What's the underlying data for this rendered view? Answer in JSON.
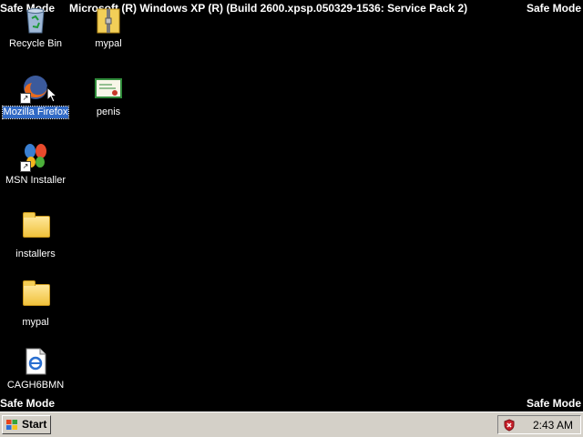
{
  "overlay": {
    "safe_mode": "Safe Mode",
    "build_line": "Microsoft (R) Windows XP (R) (Build 2600.xpsp.050329-1536: Service Pack 2)"
  },
  "icons": [
    {
      "label": "Recycle Bin",
      "icon": "recycle-bin-icon"
    },
    {
      "label": "mypal",
      "icon": "zip-folder-icon"
    },
    {
      "label": "Mozilla Firefox",
      "icon": "firefox-icon",
      "selected": true
    },
    {
      "label": "penis",
      "icon": "certificate-icon"
    },
    {
      "label": "MSN Installer",
      "icon": "msn-butterfly-icon"
    },
    {
      "label": "installers",
      "icon": "folder-icon"
    },
    {
      "label": "mypal",
      "icon": "folder-icon"
    },
    {
      "label": "CAGH6BMN",
      "icon": "html-document-icon"
    }
  ],
  "taskbar": {
    "start_label": "Start",
    "clock": "2:43 AM",
    "tray_icon": "security-shield-icon"
  },
  "colors": {
    "desktop": "#000000",
    "taskbar": "#d4d0c8",
    "selection": "#316ac5"
  }
}
